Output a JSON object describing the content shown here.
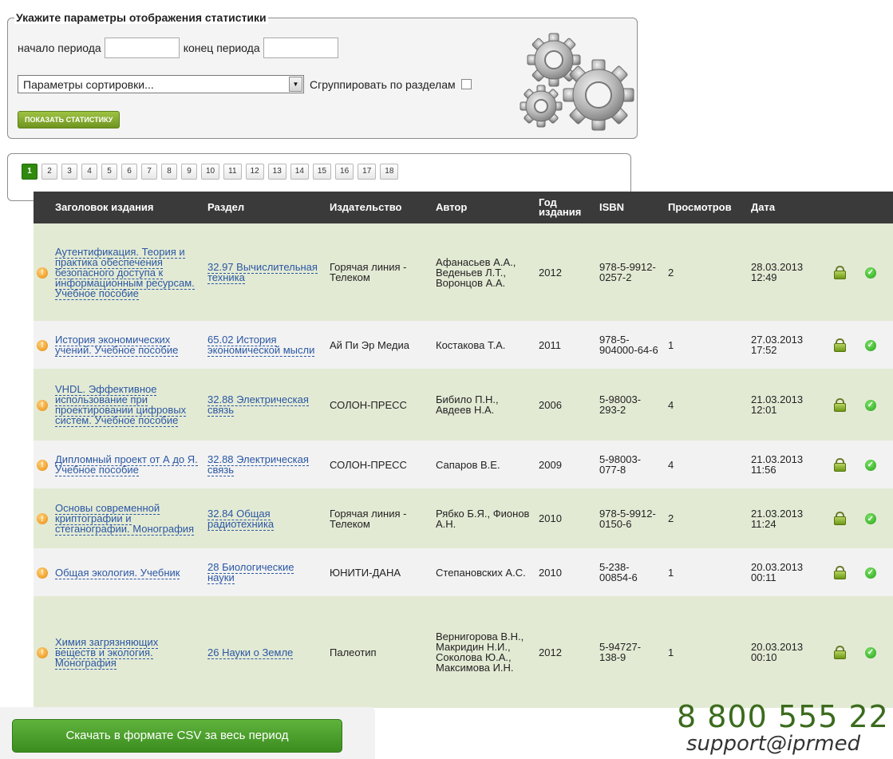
{
  "filter": {
    "legend": "Укажите параметры отображения статистики",
    "start_label": "начало периода",
    "start_value": "",
    "end_label": "конец периода",
    "end_value": "",
    "sort_select": "Параметры сортировки...",
    "group_label": "Сгруппировать по разделам",
    "group_checked": false,
    "show_button": "показать статистику",
    "gears_icon": "gears-icon"
  },
  "pager": {
    "pages": [
      "1",
      "2",
      "3",
      "4",
      "5",
      "6",
      "7",
      "8",
      "9",
      "10",
      "11",
      "12",
      "13",
      "14",
      "15",
      "16",
      "17",
      "18"
    ],
    "current": "1"
  },
  "table": {
    "headers": {
      "title": "Заголовок издания",
      "section": "Раздел",
      "publisher": "Издательство",
      "author": "Автор",
      "year_1": "Год",
      "year_2": "издания",
      "isbn": "ISBN",
      "views": "Просмотров",
      "date": "Дата"
    },
    "rows": [
      {
        "title": "Аутентификация. Теория и практика обеспечения безопасного доступа к информационным ресурсам. Учебное пособие",
        "section": "32.97 Вычислительная техника",
        "publisher": "Горячая линия - Телеком",
        "author": "Афанасьев А.А., Веденьев Л.Т., Воронцов А.А.",
        "year": "2012",
        "isbn": "978-5-9912-0257-2",
        "views": "2",
        "date": "28.03.2013 12:49"
      },
      {
        "title": "История экономических учений. Учебное пособие",
        "section": "65.02 История экономической мысли",
        "publisher": "Ай Пи Эр Медиа",
        "author": "Костакова Т.А.",
        "year": "2011",
        "isbn": "978-5-904000-64-6",
        "views": "1",
        "date": "27.03.2013 17:52"
      },
      {
        "title": "VHDL. Эффективное использование при проектировании цифровых систем. Учебное пособие",
        "section": "32.88 Электрическая связь",
        "publisher": "СОЛОН-ПРЕСС",
        "author": "Бибило П.Н., Авдеев Н.А.",
        "year": "2006",
        "isbn": "5-98003-293-2",
        "views": "4",
        "date": "21.03.2013 12:01"
      },
      {
        "title": "Дипломный проект от А до Я. Учебное пособие",
        "section": "32.88 Электрическая связь",
        "publisher": "СОЛОН-ПРЕСС",
        "author": "Сапаров В.Е.",
        "year": "2009",
        "isbn": "5-98003-077-8",
        "views": "4",
        "date": "21.03.2013 11:56"
      },
      {
        "title": "Основы современной криптографии и стеганографии. Монография",
        "section": "32.84 Общая радиотехника",
        "publisher": "Горячая линия - Телеком",
        "author": "Рябко Б.Я., Фионов А.Н.",
        "year": "2010",
        "isbn": "978-5-9912-0150-6",
        "views": "2",
        "date": "21.03.2013 11:24"
      },
      {
        "title": "Общая экология. Учебник",
        "section": "28 Биологические науки",
        "publisher": "ЮНИТИ-ДАНА",
        "author": "Степановских А.С.",
        "year": "2010",
        "isbn": "5-238-00854-6",
        "views": "1",
        "date": "20.03.2013 00:11"
      },
      {
        "title": "Химия загрязняющих веществ и экология. Монография",
        "section": "26 Науки о Земле",
        "publisher": "Палеотип",
        "author": "Вернигорова В.Н., Макридин Н.И., Соколова Ю.А., Максимова И.Н.",
        "year": "2012",
        "isbn": "5-94727-138-9",
        "views": "1",
        "date": "20.03.2013 00:10"
      }
    ]
  },
  "footer": {
    "csv_button": "Скачать в формате CSV за весь период",
    "phone": "8 800 555 22",
    "email": "support@iprmed"
  }
}
